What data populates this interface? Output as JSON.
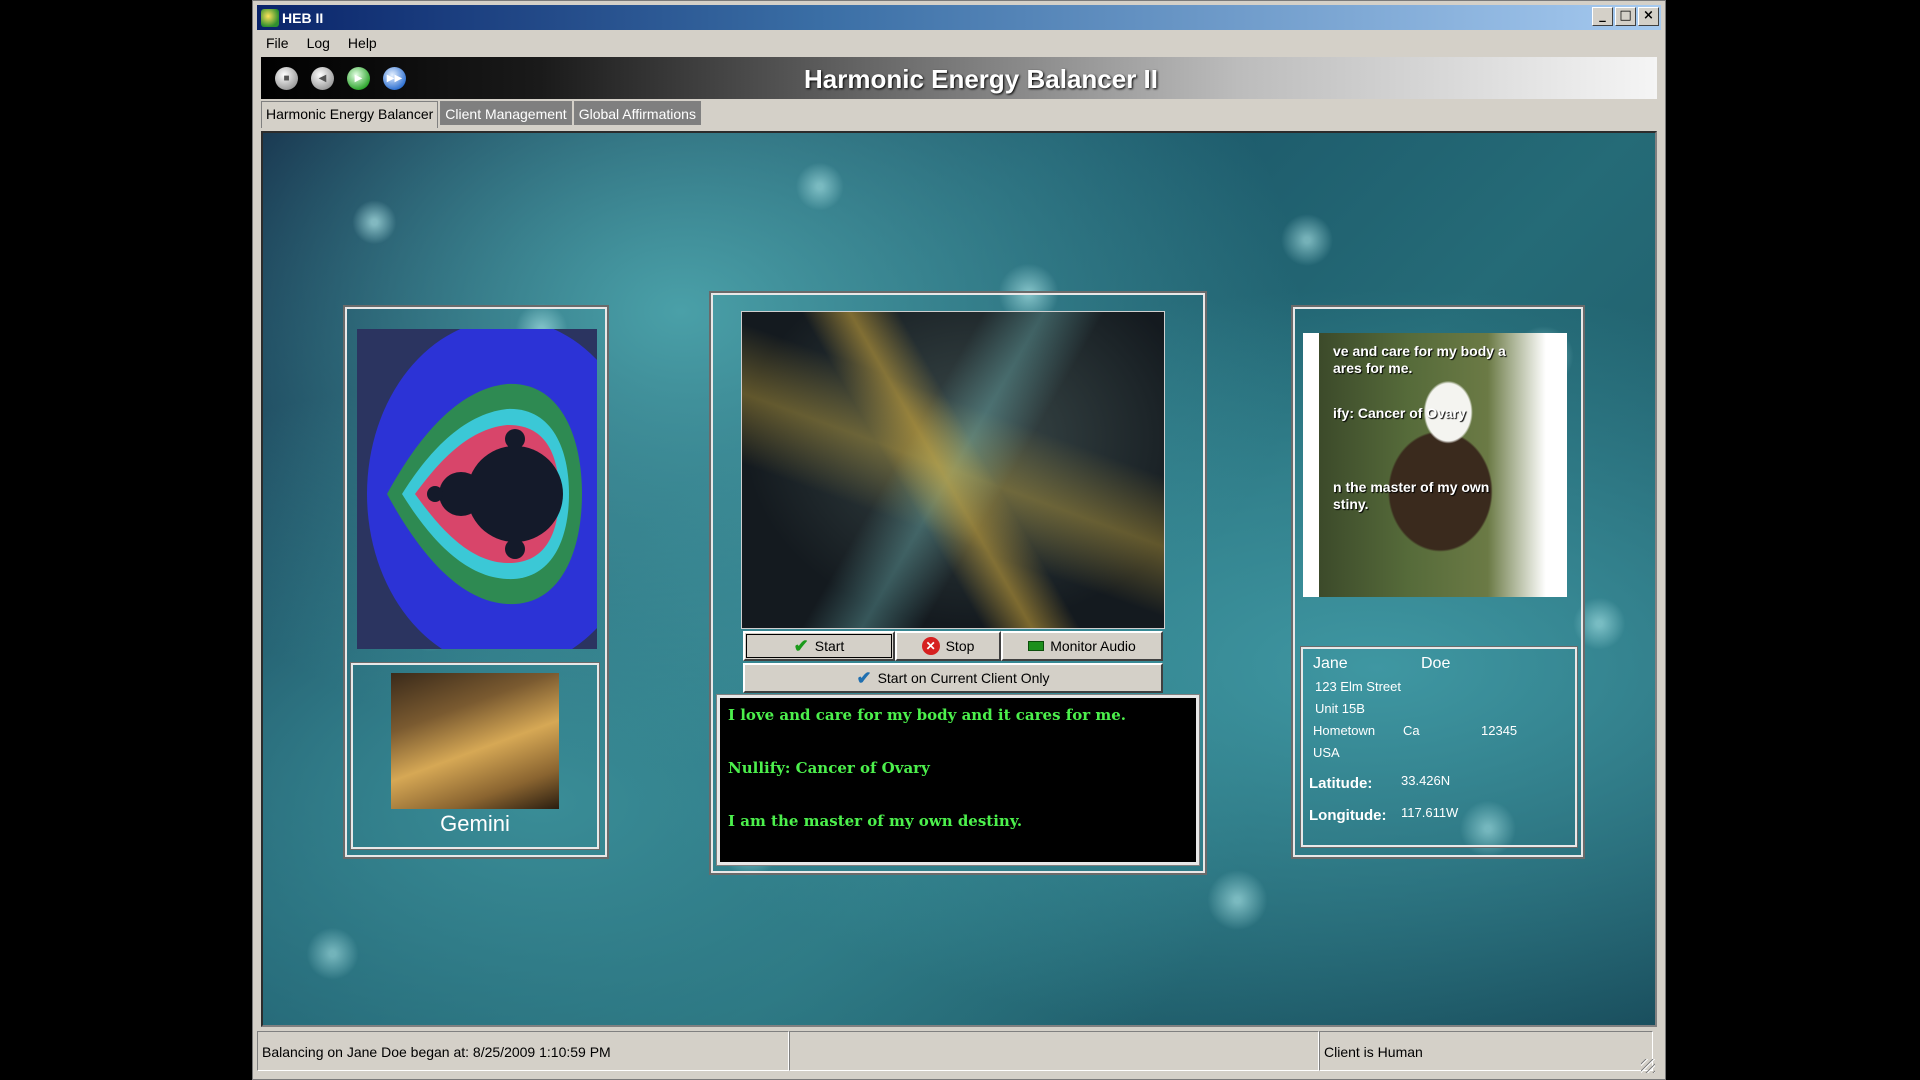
{
  "window": {
    "title": "HEB II",
    "controls": [
      "_",
      "□",
      "×"
    ]
  },
  "menu": {
    "items": [
      "File",
      "Log",
      "Help"
    ]
  },
  "banner": {
    "title": "Harmonic Energy Balancer II"
  },
  "toolbar": {
    "icons": [
      "stop-icon",
      "rewind-icon",
      "play-icon",
      "forward-icon"
    ]
  },
  "tabs": [
    "Harmonic Energy Balancer",
    "Client Management",
    "Global Affirmations"
  ],
  "zodiac": {
    "label": "Gemini"
  },
  "controls": {
    "start_label": "Start",
    "stop_label": "Stop",
    "monitor_label": "Monitor Audio",
    "start_current_label": "Start on Current Client Only"
  },
  "affirmations": [
    "I love and care for my body and it cares for me.",
    "Nullify: Cancer of Ovary",
    "I am the master of my own destiny."
  ],
  "eagle_overlay": [
    "ve and care for my body a",
    "ares for me.",
    "ify: Cancer of Ovary",
    "n the master of my own",
    "stiny."
  ],
  "client": {
    "first_name": "Jane",
    "last_name": "Doe",
    "street": "123 Elm Street",
    "unit": "Unit 15B",
    "city": "Hometown",
    "state": "Ca",
    "zip": "12345",
    "country": "USA",
    "latitude_label": "Latitude:",
    "latitude": "33.426N",
    "longitude_label": "Longitude:",
    "longitude": "117.611W"
  },
  "status": {
    "left": "Balancing on Jane Doe began at: 8/25/2009 1:10:59 PM",
    "middle": "",
    "right": "Client is Human"
  }
}
